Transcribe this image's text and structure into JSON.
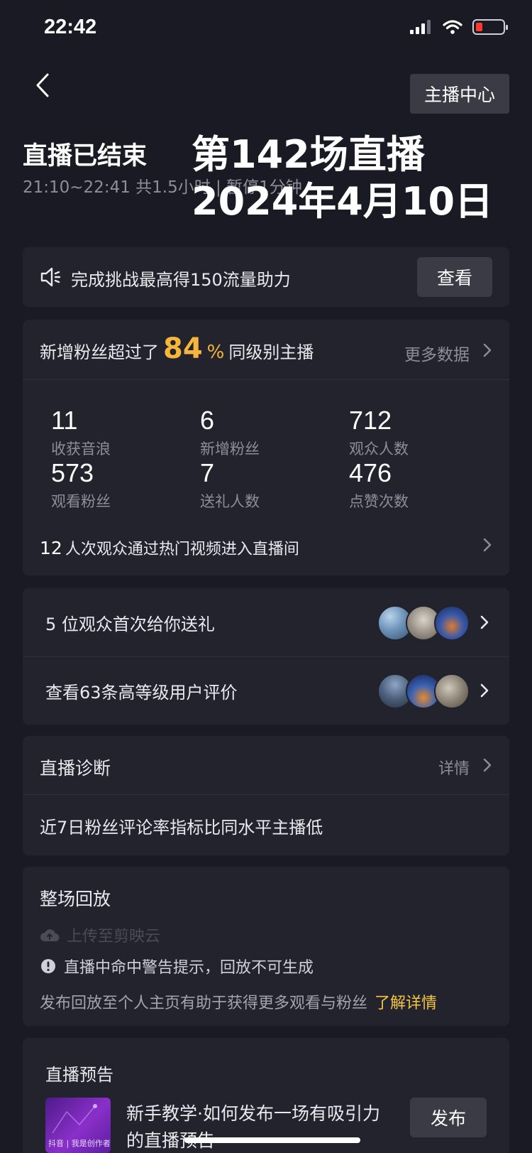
{
  "status_bar": {
    "time": "22:42"
  },
  "header": {
    "host_center_label": "主播中心",
    "live_ended_title": "直播已结束",
    "time_info": "21:10~22:41 共1.5小时 | 暂停1分钟",
    "overlay_title": "第142场直播",
    "overlay_date": "2024年4月10日"
  },
  "challenge": {
    "text": "完成挑战最高得150流量助力",
    "button_label": "查看"
  },
  "stats": {
    "headline_prefix": "新增粉丝超过了",
    "headline_percent": "84",
    "headline_percent_sign": "%",
    "headline_suffix": "同级别主播",
    "more_data_label": "更多数据",
    "items": [
      {
        "value": "11",
        "label": "收获音浪"
      },
      {
        "value": "6",
        "label": "新增粉丝"
      },
      {
        "value": "712",
        "label": "观众人数"
      },
      {
        "value": "573",
        "label": "观看粉丝"
      },
      {
        "value": "7",
        "label": "送礼人数"
      },
      {
        "value": "476",
        "label": "点赞次数"
      }
    ],
    "hot_video_count": "12",
    "hot_video_text": "人次观众通过热门视频进入直播间"
  },
  "gifts": {
    "first_gift_text": "5 位观众首次给你送礼",
    "reviews_text": "查看63条高等级用户评价"
  },
  "diagnosis": {
    "title": "直播诊断",
    "detail_label": "详情",
    "text": "近7日粉丝评论率指标比同水平主播低"
  },
  "replay": {
    "title": "整场回放",
    "upload_label": "上传至剪映云",
    "warning_text": "直播中命中警告提示，回放不可生成",
    "publish_hint": "发布回放至个人主页有助于获得更多观看与粉丝",
    "learn_more_label": "了解详情"
  },
  "preview": {
    "title": "直播预告",
    "thumb_label": "抖音 | 我是创作者学院",
    "text": "新手教学·如何发布一场有吸引力的直播预告",
    "publish_label": "发布"
  },
  "colors": {
    "accent": "#f5b63b",
    "link": "#f5c542",
    "background": "#191a23",
    "card": "#22232d"
  }
}
